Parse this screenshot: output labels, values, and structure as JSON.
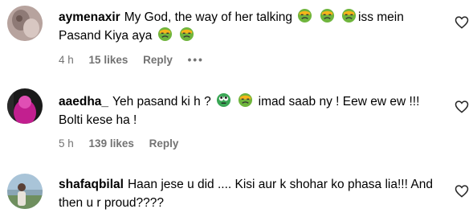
{
  "comments": [
    {
      "username": "aymenaxir",
      "text_1": "My God, the way of her talking",
      "text_2": "iss mein Pasand Kiya aya",
      "time": "4 h",
      "likes": "15 likes",
      "reply": "Reply",
      "more": "•••"
    },
    {
      "username": "aaedha_",
      "text_1": "Yeh pasand ki h ?",
      "text_2": "imad saab ny ! Eew ew ew !!! Bolti kese ha !",
      "time": "5 h",
      "likes": "139 likes",
      "reply": "Reply"
    },
    {
      "username": "shafaqbilal",
      "text_1": "Haan jese u did .... Kisi aur k shohar ko phasa lia!!! And then u r proud????"
    }
  ],
  "icons": {
    "like": "heart-outline-icon",
    "emoji_nauseated": "nauseated-face-emoji",
    "emoji_eyes_roll": "face-with-rolling-eyes-emoji"
  },
  "colors": {
    "meta_gray": "#737373",
    "emoji_green": "#6fb53d",
    "emoji_yellow": "#f5b41a"
  }
}
